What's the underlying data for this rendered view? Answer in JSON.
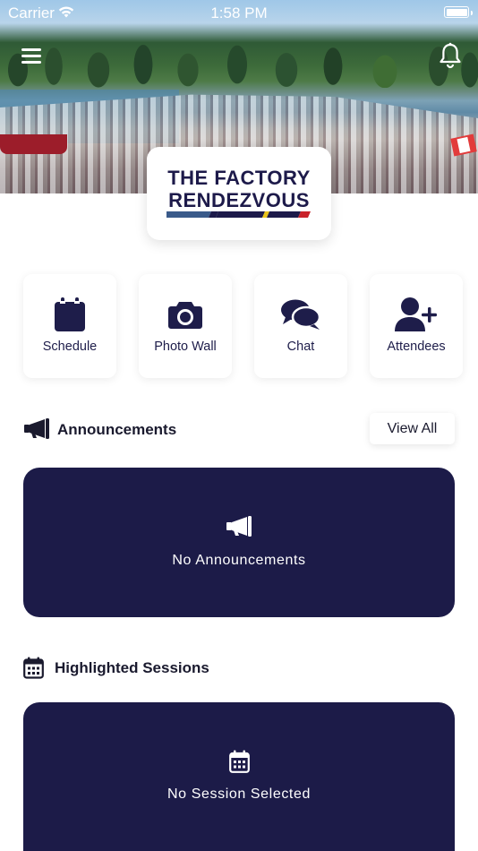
{
  "status_bar": {
    "carrier": "Carrier",
    "time": "1:58 PM"
  },
  "header": {
    "menu_icon": "hamburger-menu-icon",
    "notifications_icon": "bell-icon"
  },
  "logo": {
    "line1": "THE FACTORY",
    "line2": "RENDEZVOUS",
    "stripe_colors": [
      "#3a5a8a",
      "#1d1a4a",
      "#e8c21a",
      "#1d1a4a",
      "#c9222a"
    ]
  },
  "quick_links": [
    {
      "label": "Schedule",
      "icon": "calendar-icon"
    },
    {
      "label": "Photo Wall",
      "icon": "camera-icon"
    },
    {
      "label": "Chat",
      "icon": "chat-bubbles-icon"
    },
    {
      "label": "Attendees",
      "icon": "add-user-icon"
    }
  ],
  "announcements": {
    "title": "Announcements",
    "view_all": "View All",
    "empty_text": "No Announcements",
    "icon": "megaphone-icon"
  },
  "sessions": {
    "title": "Highlighted Sessions",
    "empty_text": "No Session Selected",
    "icon": "calendar-grid-icon"
  },
  "colors": {
    "brand_navy": "#1c1b48",
    "background": "#ffffff"
  }
}
